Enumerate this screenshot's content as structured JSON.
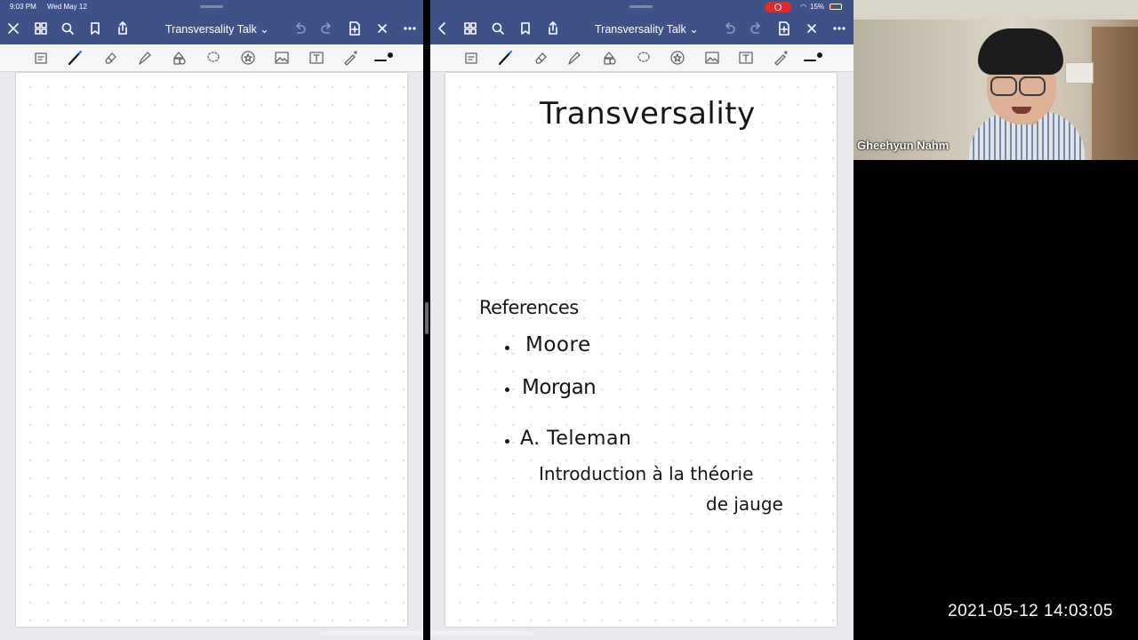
{
  "status_bar": {
    "time": "9:03 PM",
    "date": "Wed May 12",
    "battery": "15%"
  },
  "left_pane": {
    "title": "Transversality Talk"
  },
  "right_pane": {
    "title": "Transversality Talk",
    "notes": {
      "heading": "Transversality",
      "references_label": "References",
      "references": [
        "Moore",
        "Morgan",
        "A. Teleman"
      ],
      "reference_detail_line1": "Introduction à la théorie",
      "reference_detail_line2": "de jauge"
    }
  },
  "video": {
    "participant_name": "Gheehyun Nahm"
  },
  "recording_timestamp": "2021-05-12 14:03:05",
  "colors": {
    "navbar": "#3f5287",
    "toolbar": "#f6f6f8",
    "page": "#ffffff",
    "record_indicator": "#e0282e"
  }
}
